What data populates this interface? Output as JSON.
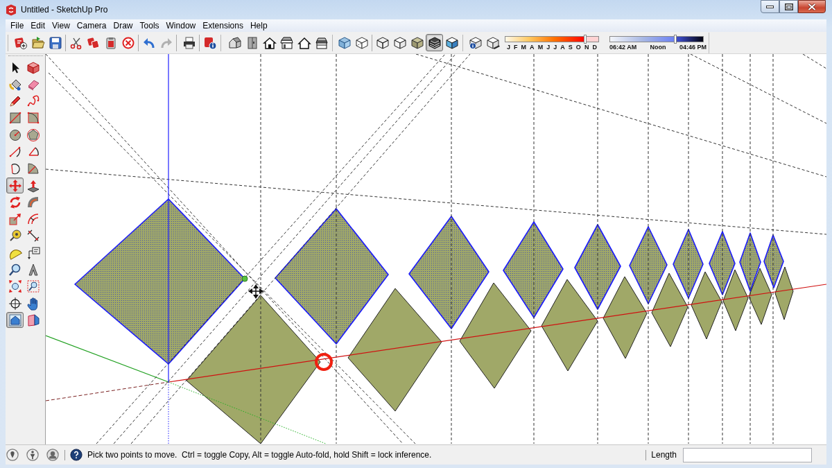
{
  "window": {
    "title": "Untitled - SketchUp Pro"
  },
  "menu": [
    "File",
    "Edit",
    "View",
    "Camera",
    "Draw",
    "Tools",
    "Window",
    "Extensions",
    "Help"
  ],
  "toolbar": {
    "groups": [
      [
        {
          "selected": false
        },
        {
          "selected": false
        },
        {
          "selected": false
        }
      ],
      [
        {
          "selected": false
        },
        {
          "selected": false
        },
        {
          "selected": false
        },
        {
          "selected": false
        }
      ],
      [
        {
          "selected": false
        },
        {
          "selected": false
        }
      ],
      [
        {
          "selected": false
        }
      ],
      [
        {
          "selected": false
        }
      ],
      [
        {
          "selected": false
        },
        {
          "selected": false
        },
        {
          "selected": false
        },
        {
          "selected": false
        },
        {
          "selected": false
        },
        {
          "selected": false
        }
      ],
      [
        {
          "selected": false
        },
        {
          "selected": false
        }
      ],
      [
        {
          "selected": false
        },
        {
          "selected": false
        },
        {
          "selected": false
        },
        {
          "selected": true
        },
        {
          "selected": false
        }
      ],
      [
        {
          "selected": false
        },
        {
          "selected": false
        }
      ]
    ]
  },
  "shadow_settings": {
    "date_slider": {
      "labels": [
        "J",
        "F",
        "M",
        "A",
        "M",
        "J",
        "J",
        "A",
        "S",
        "O",
        "N",
        "D"
      ],
      "level": 0.86
    },
    "time_slider": {
      "labels": [
        "06:42 AM",
        "Noon",
        "04:46 PM"
      ],
      "level": 0.7
    }
  },
  "tool_palette": {
    "tools": [
      {
        "selected": false
      },
      {
        "selected": false
      },
      {
        "selected": false
      },
      {
        "selected": false
      },
      {
        "selected": false
      },
      {
        "selected": false
      },
      {
        "selected": false
      },
      {
        "selected": false
      },
      {
        "selected": false
      },
      {
        "selected": false
      },
      {
        "selected": false
      },
      {
        "selected": false
      },
      {
        "selected": false
      },
      {
        "selected": false
      },
      {
        "selected": true
      },
      {
        "selected": false
      },
      {
        "selected": false
      },
      {
        "selected": false
      },
      {
        "selected": false
      },
      {
        "selected": false
      },
      {
        "selected": false
      },
      {
        "selected": false
      },
      {
        "selected": false
      },
      {
        "selected": false
      },
      {
        "selected": false
      },
      {
        "selected": false
      },
      {
        "selected": false
      },
      {
        "selected": false
      },
      {
        "selected": false
      },
      {
        "selected": false
      },
      {
        "selected": true
      },
      {
        "selected": false
      }
    ]
  },
  "model": {
    "faces": [
      {
        "selected": true
      },
      {
        "selected": true
      },
      {
        "selected": true
      },
      {
        "selected": true
      },
      {
        "selected": true
      },
      {
        "selected": true
      },
      {
        "selected": true
      },
      {
        "selected": true
      },
      {
        "selected": true
      },
      {
        "selected": true
      },
      {
        "selected": false
      },
      {
        "selected": false
      },
      {
        "selected": false
      },
      {
        "selected": false
      },
      {
        "selected": false
      },
      {
        "selected": false
      },
      {
        "selected": false
      },
      {
        "selected": false
      },
      {
        "selected": false
      },
      {
        "selected": false
      }
    ]
  },
  "status_bar": {
    "hint": "Pick two points to move.  Ctrl = toggle Copy, Alt = toggle Auto-fold, hold Shift = lock inference.",
    "measurement_label": "Length"
  }
}
